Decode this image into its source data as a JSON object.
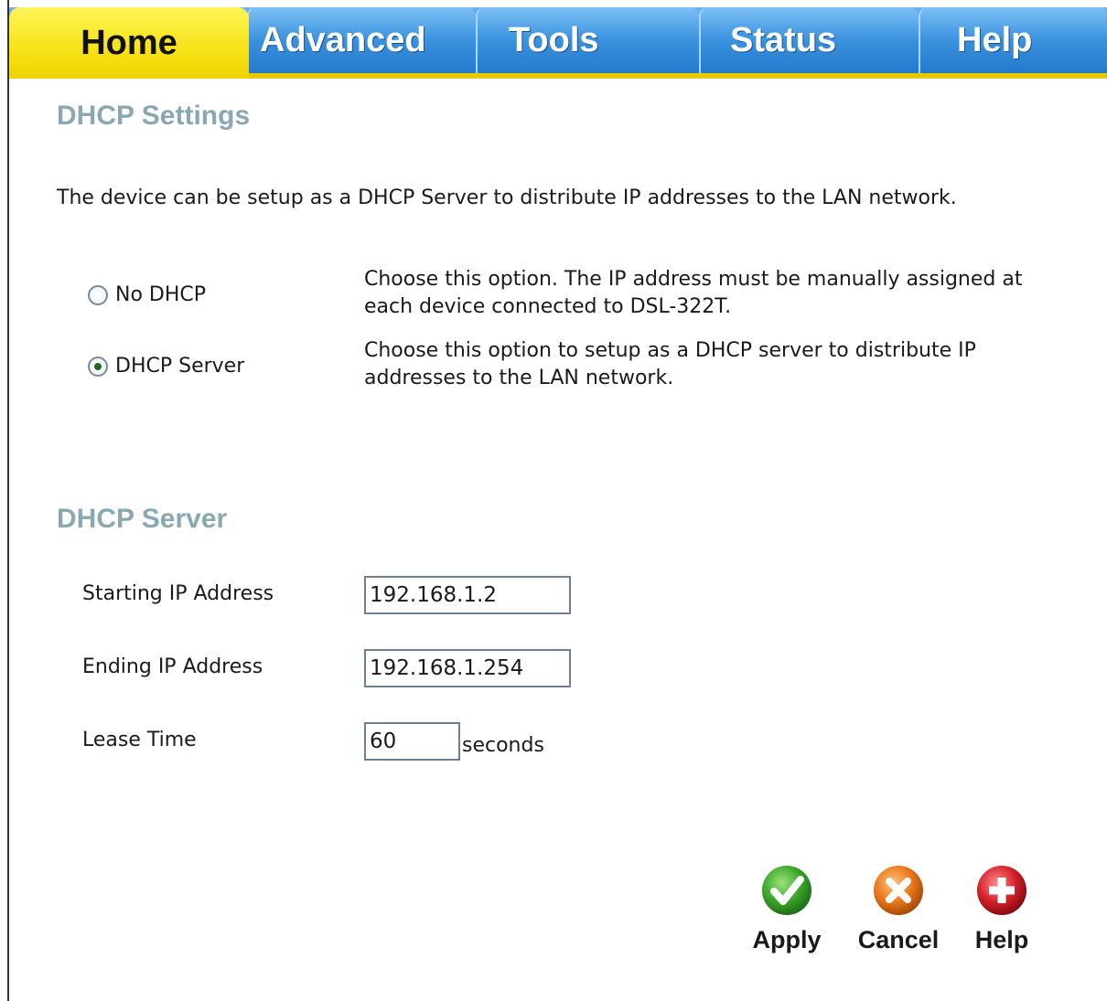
{
  "tabs": [
    {
      "label": "Home",
      "active": true
    },
    {
      "label": "Advanced",
      "active": false
    },
    {
      "label": "Tools",
      "active": false
    },
    {
      "label": "Status",
      "active": false
    },
    {
      "label": "Help",
      "active": false
    }
  ],
  "dhcp_settings": {
    "title": "DHCP Settings",
    "intro": "The device can be setup as a DHCP Server to distribute IP addresses to the LAN network.",
    "options": [
      {
        "label": "No DHCP",
        "selected": false,
        "description": "Choose this option. The IP address must be manually assigned at each device connected to DSL-322T."
      },
      {
        "label": "DHCP Server",
        "selected": true,
        "description": "Choose this option to setup as a DHCP server to distribute IP addresses to the LAN network."
      }
    ]
  },
  "dhcp_server": {
    "title": "DHCP Server",
    "starting_ip": {
      "label": "Starting IP Address",
      "value": "192.168.1.2"
    },
    "ending_ip": {
      "label": "Ending IP Address",
      "value": "192.168.1.254"
    },
    "lease_time": {
      "label": "Lease Time",
      "value": "60",
      "unit": "seconds"
    }
  },
  "actions": {
    "apply": {
      "label": "Apply",
      "icon": "checkmark-icon",
      "color": "#3aa52a"
    },
    "cancel": {
      "label": "Cancel",
      "icon": "x-icon",
      "color": "#e8771c"
    },
    "help": {
      "label": "Help",
      "icon": "plus-icon",
      "color": "#d3202a"
    }
  },
  "colors": {
    "tab_active": "#f7e41a",
    "tab_inactive": "#3a92de",
    "section_title": "#8aa8b2"
  }
}
